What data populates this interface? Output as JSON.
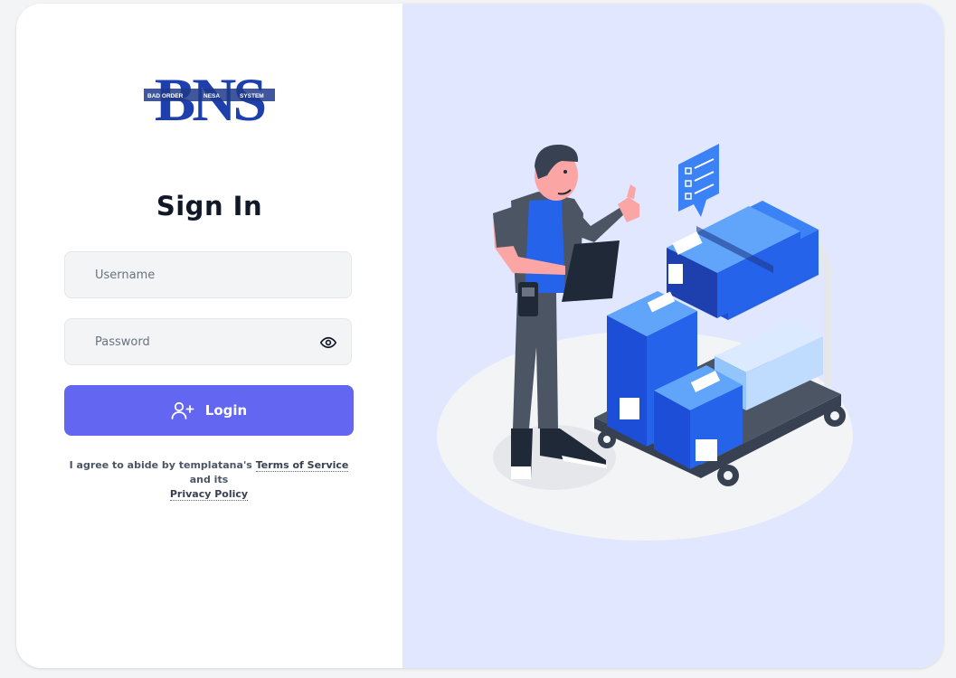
{
  "brand": {
    "logo_text": "BNS",
    "logo_left": "BAD ORDER",
    "logo_mid": "NESA",
    "logo_right": "SYSTEM",
    "logo_tag": "BAD ORDER SYSTEM",
    "color": "#1d4ed8"
  },
  "form": {
    "title": "Sign In",
    "username_placeholder": "Username",
    "password_placeholder": "Password",
    "login_label": "Login",
    "button_color": "#6366f1"
  },
  "terms": {
    "prefix": "I agree to abide by templatana's",
    "tos_link": "Terms of Service",
    "middle": "and its",
    "privacy_link": "Privacy Policy"
  },
  "icons": {
    "eye": "eye-icon",
    "user_plus": "user-plus-icon"
  },
  "illustration": {
    "panel_color": "#e0e7ff",
    "box_color": "#2563eb"
  }
}
